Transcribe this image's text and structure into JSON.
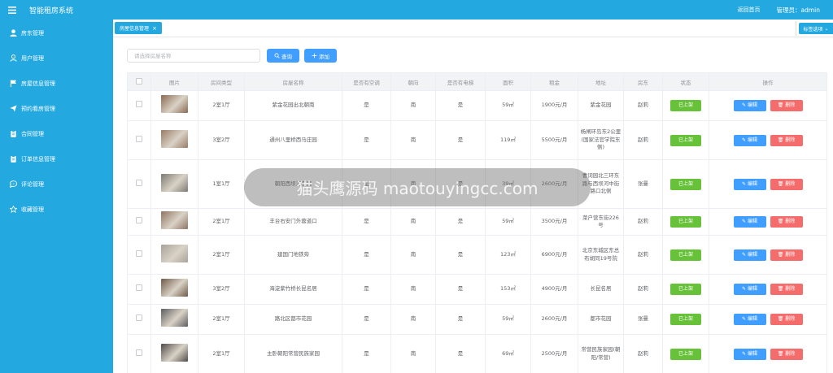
{
  "app": {
    "title": "智能租房系统",
    "home_link": "返回首页",
    "admin_label": "管理员：admin"
  },
  "sidebar": {
    "items": [
      {
        "label": "房东管理",
        "icon": "user-icon"
      },
      {
        "label": "用户管理",
        "icon": "user-outline-icon"
      },
      {
        "label": "房屋信息管理",
        "icon": "flag-icon"
      },
      {
        "label": "预约看房管理",
        "icon": "send-icon"
      },
      {
        "label": "合同管理",
        "icon": "clipboard-icon"
      },
      {
        "label": "订单信息管理",
        "icon": "clipboard-icon"
      },
      {
        "label": "评论管理",
        "icon": "comment-icon"
      },
      {
        "label": "收藏管理",
        "icon": "star-icon"
      }
    ]
  },
  "tabs": {
    "active": "房屋信息管理",
    "options": "标签选项"
  },
  "toolbar": {
    "search_placeholder": "请选择房屋名称",
    "query": "查询",
    "add": "添加"
  },
  "table": {
    "headers": [
      "",
      "图片",
      "房间类型",
      "房屋名称",
      "是否有空调",
      "朝向",
      "是否有电梯",
      "面积",
      "租金",
      "地址",
      "房东",
      "状态",
      "操作"
    ],
    "status_label": "已上架",
    "edit_label": "编辑",
    "delete_label": "删除",
    "rows": [
      {
        "type": "2室1厅",
        "name": "紫金花园出北朝南",
        "ac": "是",
        "orient": "南",
        "elevator": "是",
        "area": "59㎡",
        "rent": "1900元/月",
        "address": "紫金花园",
        "landlord": "赵莉",
        "thumb": "#8a6a52"
      },
      {
        "type": "3室2厅",
        "name": "通州八里桥西马庄园",
        "ac": "是",
        "orient": "南",
        "elevator": "是",
        "area": "119㎡",
        "rent": "5500元/月",
        "address": "杨闸环岛东2公里(国家法官学院东侧)",
        "landlord": "赵莉",
        "thumb": "#9a7b66"
      },
      {
        "type": "1室1厅",
        "name": "朝阳西坝河东里",
        "ac": "是",
        "orient": "南",
        "elevator": "是",
        "area": "39㎡",
        "rent": "2600元/月",
        "address": "曹词园北三环东路与西坝河中街路口北侧",
        "landlord": "张曼",
        "thumb": "#7d7a72"
      },
      {
        "type": "2室1厅",
        "name": "丰台右安门外蓉道口",
        "ac": "是",
        "orient": "南",
        "elevator": "是",
        "area": "59㎡",
        "rent": "3500元/月",
        "address": "菜户营东街226号",
        "landlord": "赵莉",
        "thumb": "#8f7462"
      },
      {
        "type": "2室1厅",
        "name": "建国门地铁旁",
        "ac": "是",
        "orient": "南",
        "elevator": "是",
        "area": "123㎡",
        "rent": "6900元/月",
        "address": "北京东城区东总布胡同19号院",
        "landlord": "赵莉",
        "thumb": "#a8a29a"
      },
      {
        "type": "3室2厅",
        "name": "海淀紫竹桥长昆名居",
        "ac": "是",
        "orient": "南",
        "elevator": "是",
        "area": "153㎡",
        "rent": "4900元/月",
        "address": "长昆名居",
        "landlord": "赵莉",
        "thumb": "#6f5a48"
      },
      {
        "type": "2室1厅",
        "name": "路北区都市花园",
        "ac": "是",
        "orient": "南",
        "elevator": "是",
        "area": "59㎡",
        "rent": "2600元/月",
        "address": "都市花园",
        "landlord": "张曼",
        "thumb": "#5d5d60"
      },
      {
        "type": "2室1厅",
        "name": "主卧朝阳常营民族家园",
        "ac": "是",
        "orient": "南",
        "elevator": "是",
        "area": "69㎡",
        "rent": "2500元/月",
        "address": "常营民族家园(朝阳/常营)",
        "landlord": "赵莉",
        "thumb": "#4f4b48"
      }
    ]
  },
  "watermark": "猫头鹰源码 maotouyingcc.com"
}
